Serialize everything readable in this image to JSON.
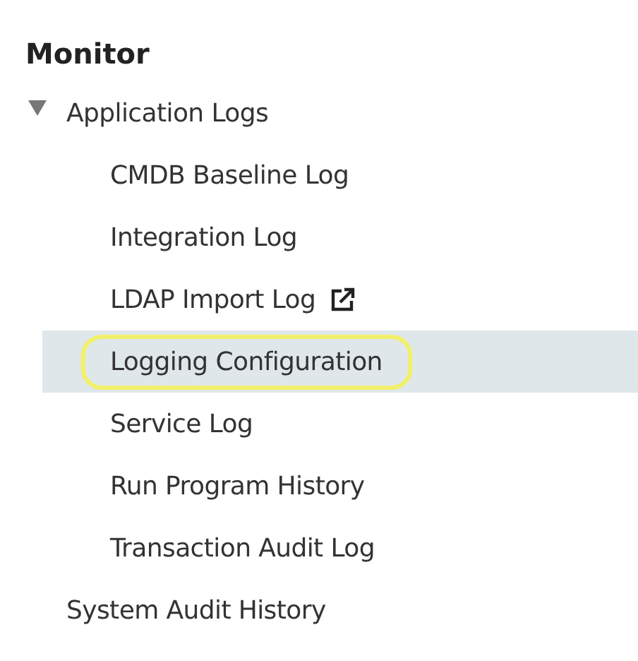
{
  "section_title": "Monitor",
  "tree": [
    {
      "label": "Application Logs",
      "expanded": true,
      "children": [
        {
          "label": "CMDB Baseline Log",
          "selected": false,
          "focused": false,
          "external": false
        },
        {
          "label": "Integration Log",
          "selected": false,
          "focused": false,
          "external": false
        },
        {
          "label": "LDAP Import Log",
          "selected": false,
          "focused": false,
          "external": true
        },
        {
          "label": "Logging Configuration",
          "selected": true,
          "focused": true,
          "external": false
        },
        {
          "label": "Service Log",
          "selected": false,
          "focused": false,
          "external": false
        },
        {
          "label": "Run Program History",
          "selected": false,
          "focused": false,
          "external": false
        },
        {
          "label": "Transaction Audit Log",
          "selected": false,
          "focused": false,
          "external": false
        }
      ]
    },
    {
      "label": "System Audit History"
    }
  ]
}
